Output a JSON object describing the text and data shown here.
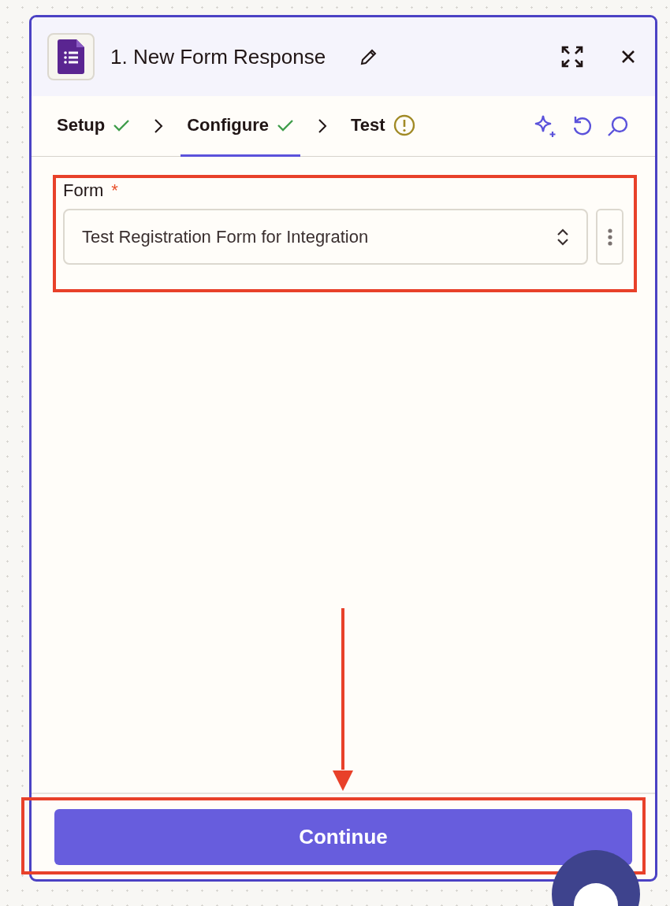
{
  "panel": {
    "title": "1. New Form Response"
  },
  "steps": [
    {
      "label": "Setup",
      "kind": "complete",
      "selected": false
    },
    {
      "label": "Configure",
      "kind": "complete",
      "selected": true
    },
    {
      "label": "Test",
      "kind": "warning",
      "selected": false
    }
  ],
  "field": {
    "label": "Form",
    "required_mark": "*",
    "value": "Test Registration Form for Integration"
  },
  "continue_button": "Continue"
}
